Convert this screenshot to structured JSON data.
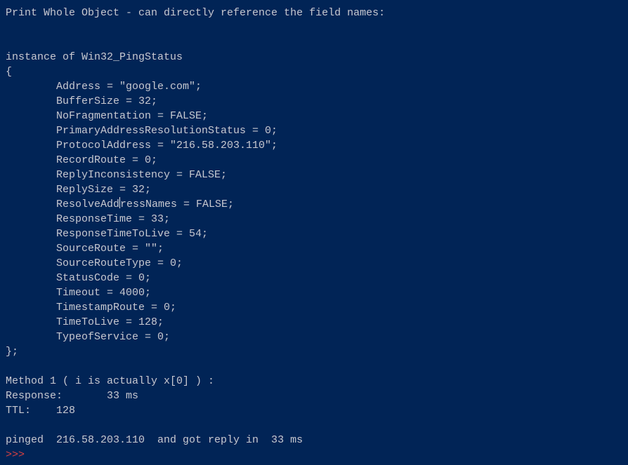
{
  "header": "Print Whole Object - can directly reference the field names:",
  "instance_line": "instance of Win32_PingStatus",
  "open_brace": "{",
  "fields": {
    "address_line": "        Address = \"google.com\";",
    "buffersize_line": "        BufferSize = 32;",
    "nofrag_line": "        NoFragmentation = FALSE;",
    "primary_line": "        PrimaryAddressResolutionStatus = 0;",
    "protocol_line": "        ProtocolAddress = \"216.58.203.110\";",
    "recordroute_line": "        RecordRoute = 0;",
    "replyinc_line": "        ReplyInconsistency = FALSE;",
    "replysize_line": "        ReplySize = 32;",
    "resolve_before": "        ResolveAdd",
    "resolve_after": "ressNames = FALSE;",
    "responsetime_line": "        ResponseTime = 33;",
    "responsettl_line": "        ResponseTimeToLive = 54;",
    "sourceroute_line": "        SourceRoute = \"\";",
    "sourceroutet_line": "        SourceRouteType = 0;",
    "statuscode_line": "        StatusCode = 0;",
    "timeout_line": "        Timeout = 4000;",
    "timestamp_line": "        TimestampRoute = 0;",
    "ttl_line": "        TimeToLive = 128;",
    "tos_line": "        TypeofService = 0;"
  },
  "close_brace": "};",
  "method1_header": "Method 1 ( i is actually x[0] ) :",
  "response_line": "Response:       33 ms",
  "ttl_result_line": "TTL:    128",
  "pinged_line": "pinged  216.58.203.110  and got reply in  33 ms",
  "prompt": ">>>"
}
